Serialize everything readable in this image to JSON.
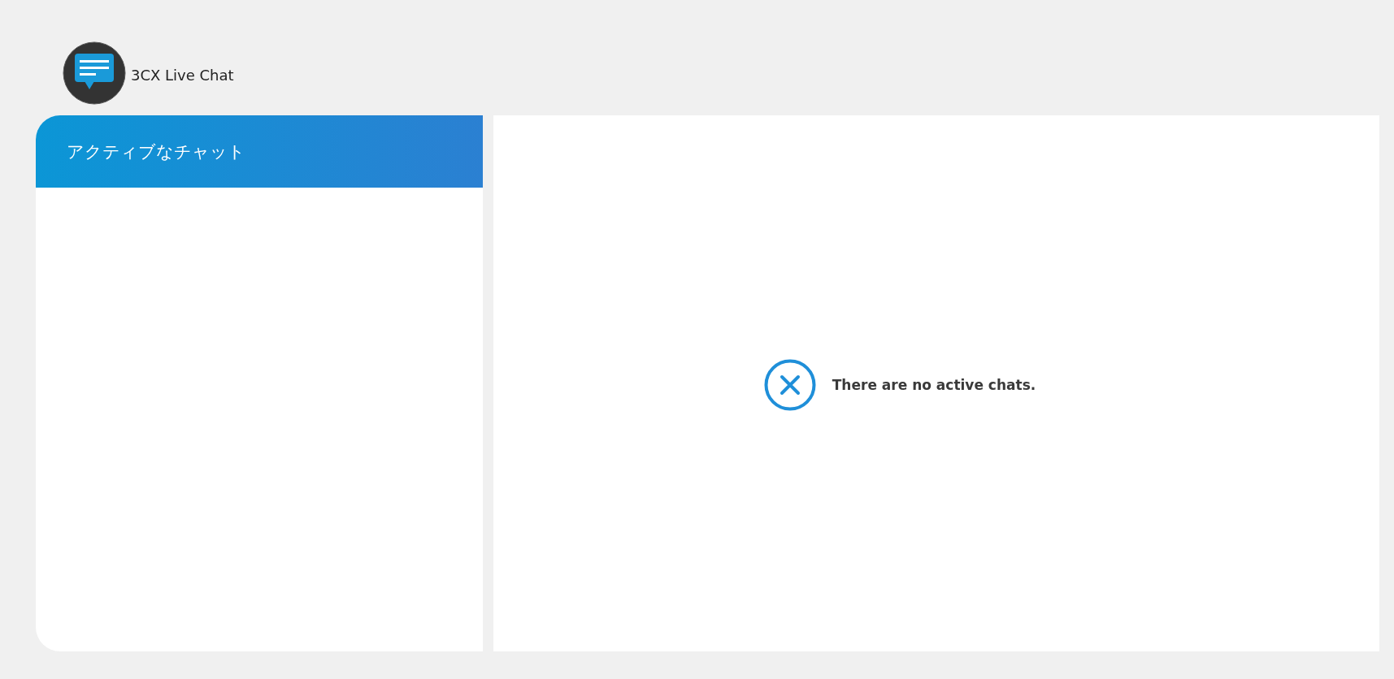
{
  "app": {
    "title": "3CX Live Chat"
  },
  "sidebar": {
    "title": "アクティブなチャット"
  },
  "main": {
    "empty_message": "There are no active chats."
  }
}
